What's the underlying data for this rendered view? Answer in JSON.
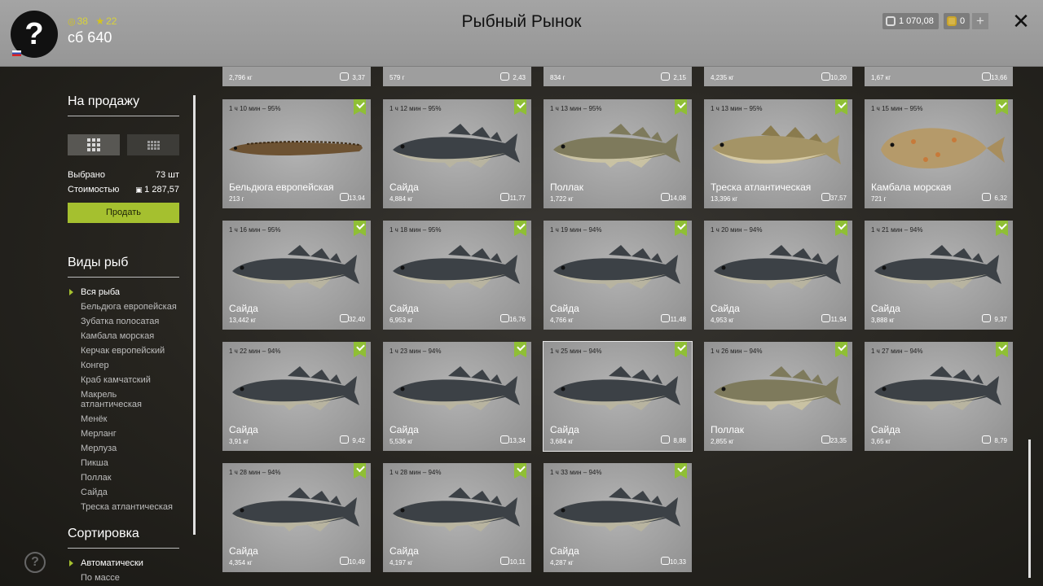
{
  "player": {
    "username": "сб 640",
    "coins": "38",
    "stars": "22",
    "avatar_symbol": "?"
  },
  "header": {
    "title": "Рыбный Рынок",
    "silver": "1 070,08",
    "gold": "0",
    "plus": "+",
    "close": "✕"
  },
  "sidebar": {
    "sale_heading": "На продажу",
    "selected_label": "Выбрано",
    "selected_value": "73 шт",
    "cost_label": "Стоимостью",
    "cost_value": "1 287,57",
    "sell_button": "Продать",
    "species_heading": "Виды рыб",
    "species": [
      "Вся рыба",
      "Бельдюга европейская",
      "Зубатка полосатая",
      "Камбала морская",
      "Керчак европейский",
      "Конгер",
      "Краб камчатский",
      "Макрель атлантическая",
      "Менёк",
      "Мерланг",
      "Мерлуза",
      "Пикша",
      "Поллак",
      "Сайда",
      "Треска атлантическая"
    ],
    "sort_heading": "Сортировка",
    "sort_options": [
      "Автоматически",
      "По массе"
    ]
  },
  "partial_row": [
    {
      "weight": "2,796 кг",
      "price": "3,37"
    },
    {
      "weight": "579 г",
      "price": "2,43"
    },
    {
      "weight": "834 г",
      "price": "2,15"
    },
    {
      "weight": "4,235 кг",
      "price": "10,20"
    },
    {
      "weight": "1,67 кг",
      "price": "13,66"
    }
  ],
  "fish_cards": [
    {
      "time": "1 ч 10 мин – 95%",
      "name": "Бельдюга европейская",
      "weight": "213 г",
      "price": "13,94",
      "kind": "eelpout"
    },
    {
      "time": "1 ч 12 мин – 95%",
      "name": "Сайда",
      "weight": "4,884 кг",
      "price": "11,77",
      "kind": "saithe"
    },
    {
      "time": "1 ч 13 мин – 95%",
      "name": "Поллак",
      "weight": "1,722 кг",
      "price": "14,08",
      "kind": "pollack"
    },
    {
      "time": "1 ч 13 мин – 95%",
      "name": "Треска атлантическая",
      "weight": "13,396 кг",
      "price": "37,57",
      "kind": "cod"
    },
    {
      "time": "1 ч 15 мин – 95%",
      "name": "Камбала морская",
      "weight": "721 г",
      "price": "6,32",
      "kind": "plaice"
    },
    {
      "time": "1 ч 16 мин – 95%",
      "name": "Сайда",
      "weight": "13,442 кг",
      "price": "32,40",
      "kind": "saithe"
    },
    {
      "time": "1 ч 18 мин – 95%",
      "name": "Сайда",
      "weight": "6,953 кг",
      "price": "16,76",
      "kind": "saithe"
    },
    {
      "time": "1 ч 19 мин – 94%",
      "name": "Сайда",
      "weight": "4,766 кг",
      "price": "11,48",
      "kind": "saithe"
    },
    {
      "time": "1 ч 20 мин – 94%",
      "name": "Сайда",
      "weight": "4,953 кг",
      "price": "11,94",
      "kind": "saithe"
    },
    {
      "time": "1 ч 21 мин – 94%",
      "name": "Сайда",
      "weight": "3,888 кг",
      "price": "9,37",
      "kind": "saithe"
    },
    {
      "time": "1 ч 22 мин – 94%",
      "name": "Сайда",
      "weight": "3,91 кг",
      "price": "9,42",
      "kind": "saithe"
    },
    {
      "time": "1 ч 23 мин – 94%",
      "name": "Сайда",
      "weight": "5,536 кг",
      "price": "13,34",
      "kind": "saithe"
    },
    {
      "time": "1 ч 25 мин – 94%",
      "name": "Сайда",
      "weight": "3,684 кг",
      "price": "8,88",
      "kind": "saithe",
      "selected": true
    },
    {
      "time": "1 ч 26 мин – 94%",
      "name": "Поллак",
      "weight": "2,855 кг",
      "price": "23,35",
      "kind": "pollack"
    },
    {
      "time": "1 ч 27 мин – 94%",
      "name": "Сайда",
      "weight": "3,65 кг",
      "price": "8,79",
      "kind": "saithe"
    },
    {
      "time": "1 ч 28 мин – 94%",
      "name": "Сайда",
      "weight": "4,354 кг",
      "price": "10,49",
      "kind": "saithe"
    },
    {
      "time": "1 ч 28 мин – 94%",
      "name": "Сайда",
      "weight": "4,197 кг",
      "price": "10,11",
      "kind": "saithe"
    },
    {
      "time": "1 ч 33 мин – 94%",
      "name": "Сайда",
      "weight": "4,287 кг",
      "price": "10,33",
      "kind": "saithe"
    }
  ],
  "help_symbol": "?"
}
